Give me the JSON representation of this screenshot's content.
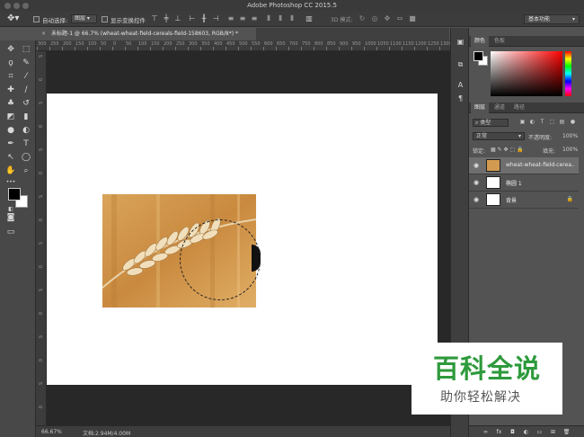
{
  "window": {
    "title": "Adobe Photoshop CC 2015.5"
  },
  "options_bar": {
    "auto_select_label": "自动选择:",
    "auto_select_target": "图层",
    "show_transform_label": "显示变换控件",
    "mode_3d_label": "3D 模式:",
    "workspace": "基本功能"
  },
  "document": {
    "tab_title": "未标题-1 @ 66.7% (wheat-wheat-field-cereals-field-158603, RGB/8*) *",
    "zoom": "66.67%",
    "doc_size": "文档:2.94M/4.00M"
  },
  "ruler_top_labels": [
    "300",
    "250",
    "200",
    "150",
    "100",
    "50",
    "0",
    "50",
    "100",
    "150",
    "200",
    "250",
    "300",
    "350",
    "400",
    "450",
    "500",
    "550",
    "600",
    "650",
    "700",
    "750",
    "800",
    "850",
    "900",
    "950",
    "1000",
    "1050",
    "1100",
    "1150",
    "1200",
    "1250",
    "1300"
  ],
  "ruler_left_labels": [
    "5",
    "0",
    "5",
    "0",
    "5",
    "0",
    "5",
    "0",
    "5",
    "0",
    "5",
    "0",
    "5",
    "0",
    "5",
    "0"
  ],
  "color_panel": {
    "tabs": [
      "颜色",
      "色板"
    ],
    "foreground": "#000000",
    "background": "#ffffff"
  },
  "layers_panel": {
    "tabs": [
      "图层",
      "通道",
      "路径"
    ],
    "filter_kind": "类型",
    "blend_mode": "正常",
    "opacity_label": "不透明度:",
    "opacity_value": "100%",
    "lock_label": "锁定:",
    "fill_label": "填充:",
    "fill_value": "100%",
    "layers": [
      {
        "name": "wheat-wheat-field-cerea...",
        "selected": true
      },
      {
        "name": "椭圆 1",
        "selected": false
      },
      {
        "name": "背景",
        "selected": false
      }
    ]
  },
  "watermark": {
    "big_text": "百科全说",
    "small_text": "助你轻松解决"
  }
}
